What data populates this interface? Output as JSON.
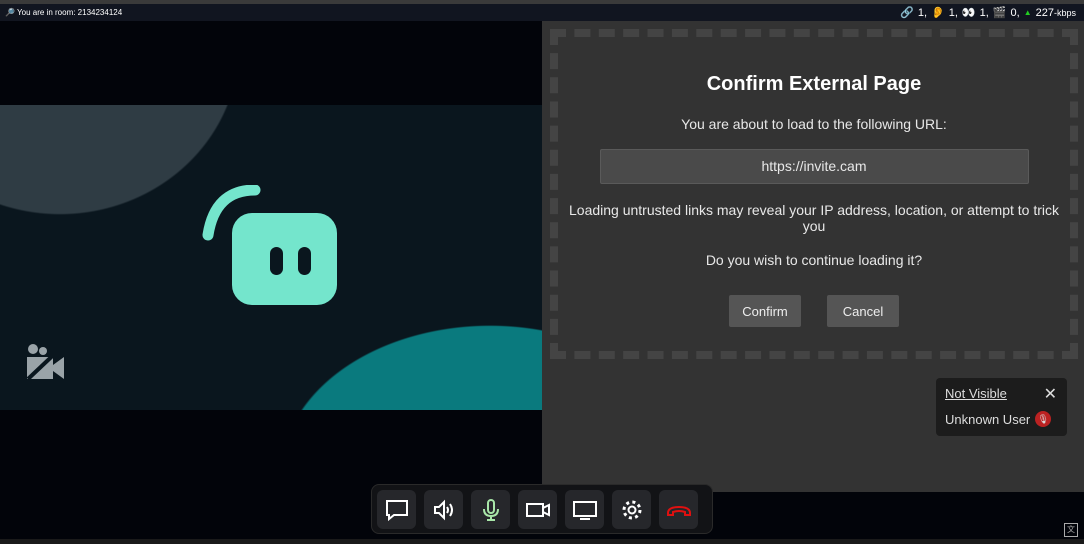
{
  "topbar": {
    "room_label": "You are in room: 2134234124",
    "links": "1,",
    "ears": "1,",
    "eyes": "1,",
    "clapper": "0,",
    "bitrate": "227",
    "bitrate_unit": "-kbps"
  },
  "dialog": {
    "title": "Confirm External Page",
    "intro": "You are about to load to the following URL:",
    "url": "https://invite.cam",
    "warning": "Loading untrusted links may reveal your IP address, location, or attempt to trick you",
    "question": "Do you wish to continue loading it?",
    "confirm": "Confirm",
    "cancel": "Cancel"
  },
  "card": {
    "status": "Not Visible",
    "user": "Unknown User",
    "close": "✕"
  },
  "colors": {
    "logo": "#74e5cc",
    "mic": "#a8e6a8",
    "hangup": "#e01010"
  },
  "toolbar": [
    "chat-icon",
    "speaker-icon",
    "mic-icon",
    "camera-icon",
    "screenshare-icon",
    "gear-icon",
    "hangup-icon"
  ]
}
